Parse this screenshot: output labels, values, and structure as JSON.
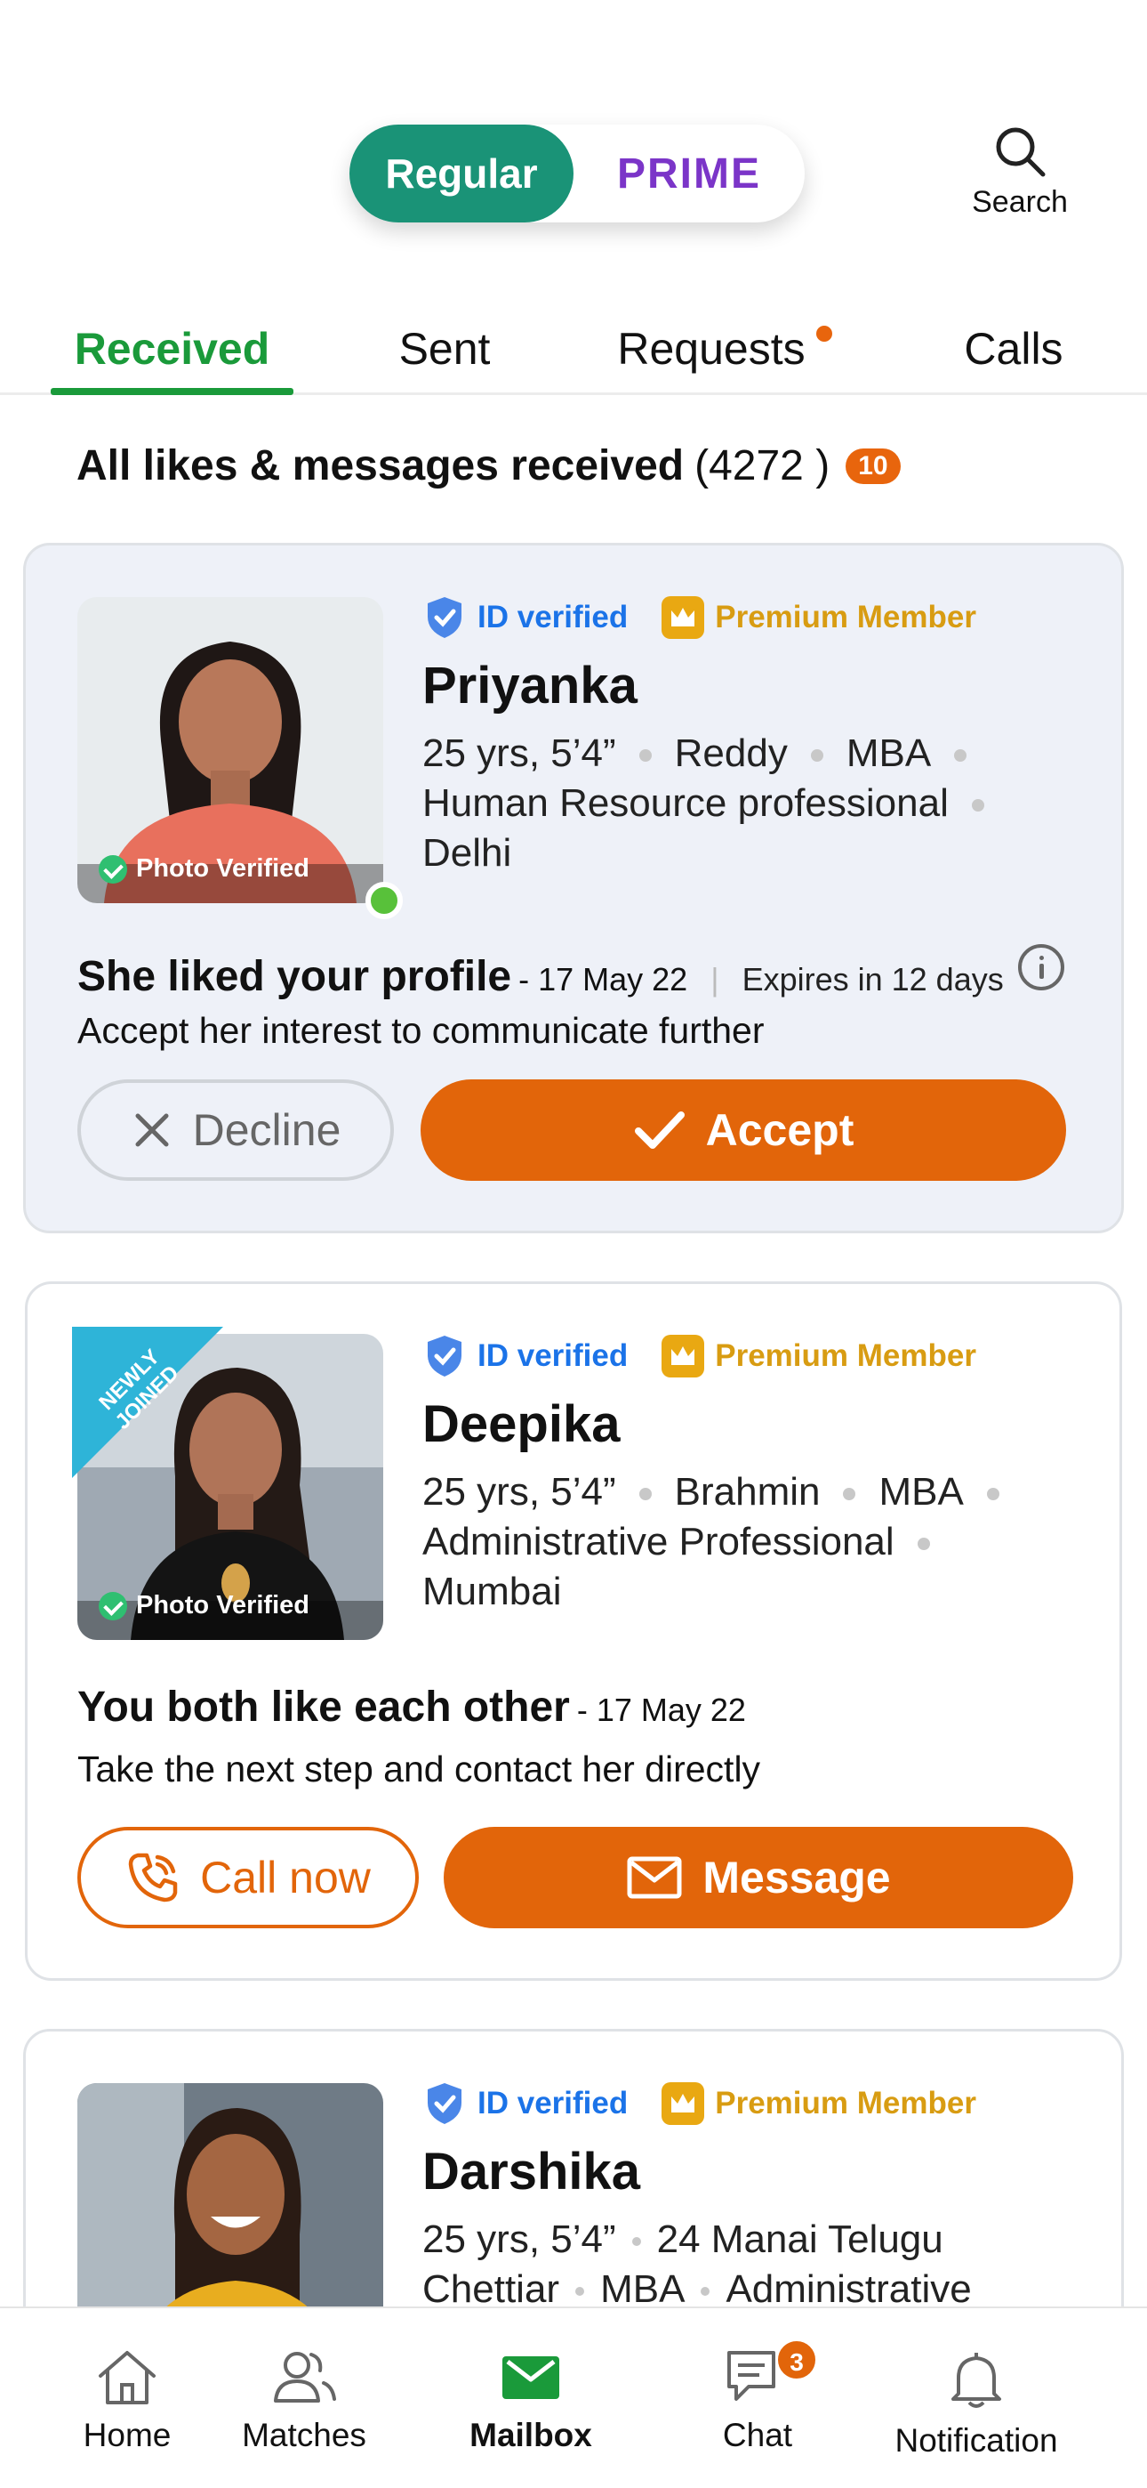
{
  "toggle": {
    "regular": "Regular",
    "prime": "PRIME"
  },
  "search_label": "Search",
  "tabs": [
    {
      "label": "Received"
    },
    {
      "label": "Sent"
    },
    {
      "label": "Requests"
    },
    {
      "label": "Calls"
    }
  ],
  "heading": {
    "title": "All likes & messages received",
    "count": "(4272 )",
    "badge": "10"
  },
  "profiles": [
    {
      "id_verified": "ID verified",
      "premium": "Premium Member",
      "name": "Priyanka",
      "details1": [
        "25 yrs, 5’4”",
        "Reddy",
        "MBA"
      ],
      "details2": "Human Resource professional",
      "details3": "Delhi",
      "photo_verified": "Photo Verified",
      "message": "She liked your profile",
      "date": "- 17 May 22",
      "separator": "|",
      "expires": "Expires in 12 days",
      "sub": "Accept her interest to communicate further",
      "decline": "Decline",
      "accept": "Accept"
    },
    {
      "id_verified": "ID verified",
      "premium": "Premium Member",
      "name": "Deepika",
      "details1": [
        "25 yrs, 5’4”",
        "Brahmin",
        "MBA"
      ],
      "details2": "Administrative Professional",
      "details3": "Mumbai",
      "photo_verified": "Photo Verified",
      "newly_joined": "NEWLY JOINED",
      "message": "You both like each other",
      "date": "- 17 May 22",
      "sub": "Take the next step and contact her directly",
      "call": "Call now",
      "msg": "Message"
    },
    {
      "id_verified": "ID verified",
      "premium": "Premium Member",
      "name": "Darshika",
      "details1": [
        "25 yrs, 5’4”",
        "24 Manai Telugu"
      ],
      "details2": [
        "Chettiar",
        "MBA",
        "Administrative"
      ]
    }
  ],
  "nav": [
    {
      "label": "Home"
    },
    {
      "label": "Matches"
    },
    {
      "label": "Mailbox"
    },
    {
      "label": "Chat",
      "badge": "3"
    },
    {
      "label": "Notification"
    }
  ],
  "colors": {
    "green": "#1a9377",
    "tab_green": "#1a9a3a",
    "orange": "#e2650a",
    "prime_purple": "#7b35c8",
    "id_blue": "#1b73e8",
    "premium_gold": "#d89c12"
  }
}
